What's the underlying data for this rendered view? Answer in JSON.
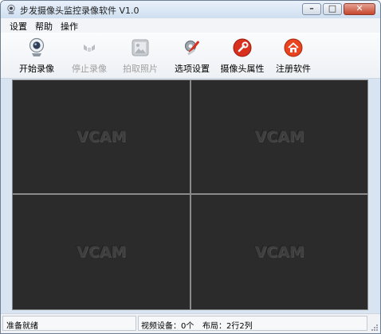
{
  "window": {
    "title": "步发摄像头监控录像软件 V1.0",
    "minimize_glyph": "–",
    "maximize_glyph": "□",
    "close_glyph": "✕"
  },
  "menu": [
    "设置",
    "帮助",
    "操作"
  ],
  "toolbar": {
    "buttons": [
      {
        "label": "开始录像",
        "icon": "webcam-icon",
        "enabled": true
      },
      {
        "label": "停止录像",
        "icon": "stop-record-icon",
        "enabled": false
      },
      {
        "label": "拍取照片",
        "icon": "photo-icon",
        "enabled": false
      },
      {
        "label": "选项设置",
        "icon": "settings-tools-icon",
        "enabled": true
      },
      {
        "label": "摄像头属性",
        "icon": "wrench-icon",
        "enabled": true
      },
      {
        "label": "注册软件",
        "icon": "home-icon",
        "enabled": true
      }
    ]
  },
  "video": {
    "cells": [
      {
        "watermark": "VCAM"
      },
      {
        "watermark": "VCAM"
      },
      {
        "watermark": "VCAM"
      },
      {
        "watermark": "VCAM"
      }
    ]
  },
  "status": {
    "ready": "准备就绪",
    "devices": "视频设备：0个",
    "layout": "布局：2行2列"
  },
  "colors": {
    "video_bg": "#2b2b2b",
    "divider": "#8a8a8a",
    "accent_red": "#d9301e"
  }
}
